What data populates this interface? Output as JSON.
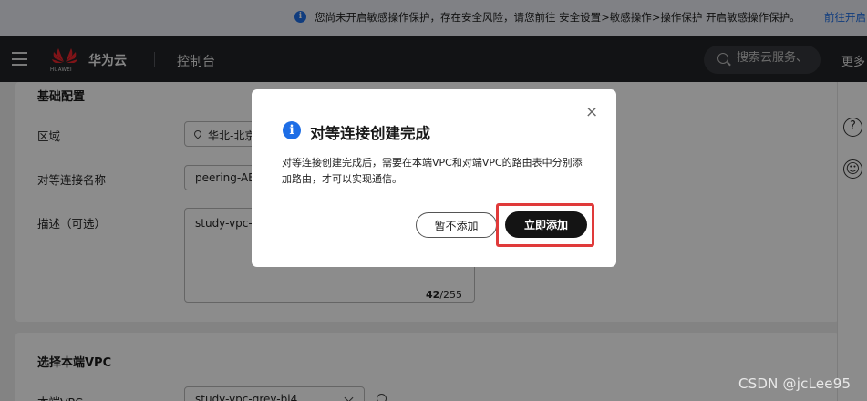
{
  "notice": {
    "text": "您尚未开启敏感操作保护，存在安全风险，请您前往 安全设置>敏感操作>操作保护 开启敏感操作保护。",
    "link": "前往开启"
  },
  "topbar": {
    "logo_text": "HUAWEI",
    "brand": "华为云",
    "console": "控制台",
    "search_placeholder": "搜索云服务、",
    "more": "更多"
  },
  "form": {
    "basic_section": "基础配置",
    "region_label": "区域",
    "region_value": "华北-北京",
    "name_label": "对等连接名称",
    "name_value": "peering-AB",
    "desc_label": "描述（可选）",
    "desc_value": "study-vpc-gr",
    "desc_count": "42",
    "desc_max": "/255",
    "local_vpc_section": "选择本端VPC",
    "local_vpc_label": "本端VPC",
    "local_vpc_value": "study-vpc-grey-bj4"
  },
  "modal": {
    "title": "对等连接创建完成",
    "body": "对等连接创建完成后，需要在本端VPC和对端VPC的路由表中分别添加路由，才可以实现通信。",
    "cancel_label": "暂不添加",
    "confirm_label": "立即添加",
    "close_symbol": "×"
  },
  "rightrail": {
    "help_symbol": "?",
    "feedback_symbol": "☺"
  },
  "watermark": "CSDN @jcLee95",
  "colors": {
    "accent": "#1e6ee6",
    "topbar": "#222427",
    "highlight": "#e03a3a",
    "primary_button": "#141414"
  }
}
